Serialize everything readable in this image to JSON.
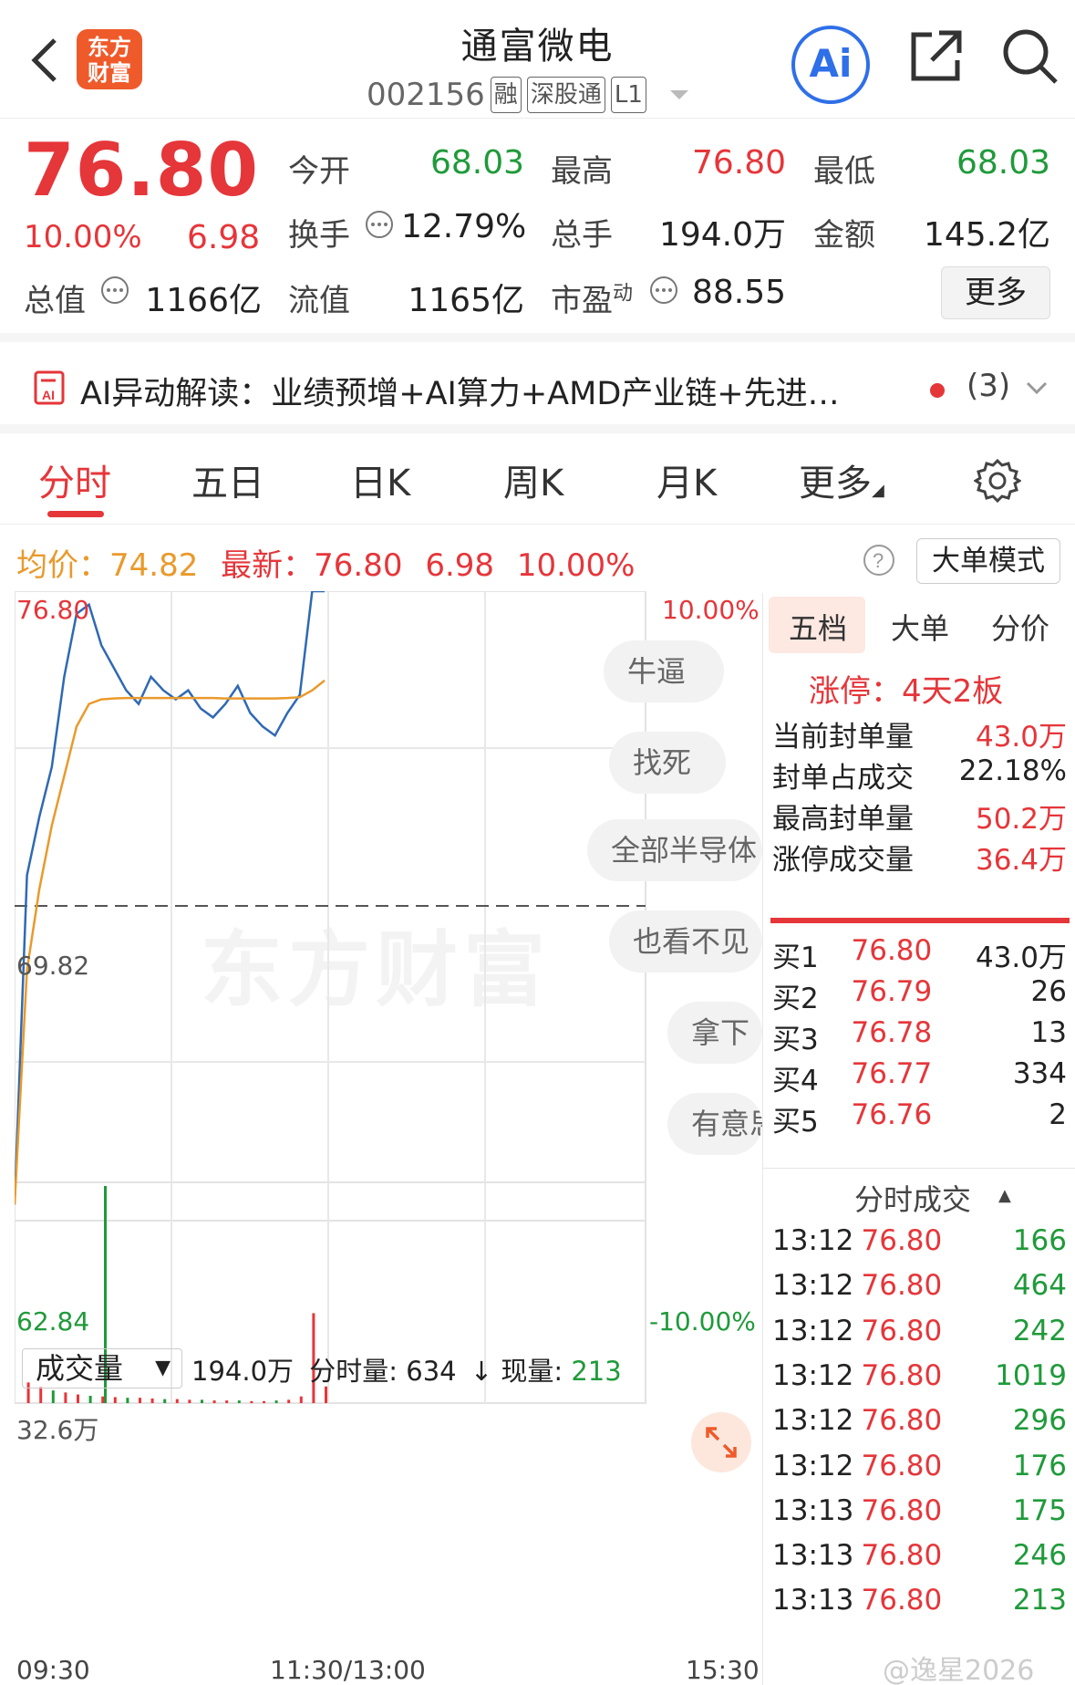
{
  "header": {
    "logo_text_1": "东方",
    "logo_text_2": "财富",
    "title": "通富微电",
    "code": "002156",
    "tags": [
      "融",
      "深股通",
      "L1"
    ],
    "ai_label": "Ai"
  },
  "quote": {
    "price": "76.80",
    "change_pct": "10.00%",
    "change": "6.98",
    "open_label": "今开",
    "open": "68.03",
    "high_label": "最高",
    "high": "76.80",
    "low_label": "最低",
    "low": "68.03",
    "turnover_label": "换手",
    "turnover": "12.79%",
    "volume_label": "总手",
    "volume": "194.0万",
    "amount_label": "金额",
    "amount": "145.2亿",
    "mktcap_label": "总值",
    "mktcap": "1166亿",
    "float_label": "流值",
    "float": "1165亿",
    "pe_label": "市盈",
    "pe_sup": "动",
    "pe": "88.55",
    "more_label": "更多"
  },
  "ai_bar": {
    "text": "AI异动解读：业绩预增+AI算力+AMD产业链+先进…",
    "count": "(3)"
  },
  "tabs": [
    "分时",
    "五日",
    "日K",
    "周K",
    "月K",
    "更多"
  ],
  "info_line": {
    "avg_label": "均价：",
    "avg": "74.82",
    "latest_label": "最新：",
    "latest": "76.80",
    "chg": "6.98",
    "pct": "10.00%",
    "mode_btn": "大单模式"
  },
  "chart": {
    "y_top": "76.80",
    "y_mid": "69.82",
    "y_bottom": "62.84",
    "pct_top": "10.00%",
    "pct_bottom": "-10.00%",
    "x_labels": [
      "09:30",
      "11:30/13:00",
      "15:30"
    ],
    "watermark": "东方财富",
    "vol_max": "32.6万"
  },
  "chart_data": {
    "type": "line",
    "title": "",
    "xlabel": "",
    "ylabel": "",
    "ylim": [
      62.84,
      76.8
    ],
    "series": [
      {
        "name": "最新",
        "values": [
          63.2,
          70.5,
          71.8,
          72.9,
          74.9,
          76.3,
          76.5,
          75.6,
          75.1,
          74.6,
          74.3,
          74.9,
          74.6,
          74.4,
          74.6,
          74.2,
          74.0,
          74.3,
          74.7,
          74.1,
          73.8,
          73.6,
          74.1,
          74.5,
          76.8,
          76.8
        ]
      },
      {
        "name": "均价",
        "values": [
          63.2,
          68.4,
          70.2,
          71.6,
          72.7,
          73.8,
          74.3,
          74.4,
          74.42,
          74.43,
          74.43,
          74.43,
          74.43,
          74.43,
          74.43,
          74.43,
          74.43,
          74.42,
          74.42,
          74.42,
          74.42,
          74.42,
          74.43,
          74.45,
          74.6,
          74.82
        ]
      }
    ],
    "volume": [
      32.6,
      3.1,
      2.4,
      1.9,
      1.6,
      1.3,
      1.1,
      1.0,
      0.9,
      0.8,
      0.8,
      0.7,
      0.6,
      0.6,
      0.5,
      0.5,
      0.4,
      0.4,
      0.4,
      0.3,
      0.3,
      0.4,
      0.5,
      1.0,
      13.5,
      2.5
    ]
  },
  "volume_bar": {
    "select": "成交量",
    "total": "194.0万",
    "period_label": "分时量:",
    "period": "634",
    "now_label": "现量:",
    "now": "213"
  },
  "bubbles": [
    "牛逼",
    "找死",
    "全部半导体",
    "也看不见",
    "拿下",
    "有意思"
  ],
  "right": {
    "tabs": [
      "五档",
      "大单",
      "分价"
    ],
    "limit_text": "涨停：4天2板",
    "stats": [
      {
        "label": "当前封单量",
        "value": "43.0万"
      },
      {
        "label": "封单占成交",
        "value": "22.18%"
      },
      {
        "label": "最高封单量",
        "value": "50.2万"
      },
      {
        "label": "涨停成交量",
        "value": "36.4万"
      }
    ],
    "bids": [
      {
        "label": "买1",
        "price": "76.80",
        "vol": "43.0万"
      },
      {
        "label": "买2",
        "price": "76.79",
        "vol": "26"
      },
      {
        "label": "买3",
        "price": "76.78",
        "vol": "13"
      },
      {
        "label": "买4",
        "price": "76.77",
        "vol": "334"
      },
      {
        "label": "买5",
        "price": "76.76",
        "vol": "2"
      }
    ],
    "ticks_title": "分时成交",
    "ticks": [
      {
        "time": "13:12",
        "price": "76.80",
        "vol": "166"
      },
      {
        "time": "13:12",
        "price": "76.80",
        "vol": "464"
      },
      {
        "time": "13:12",
        "price": "76.80",
        "vol": "242"
      },
      {
        "time": "13:12",
        "price": "76.80",
        "vol": "1019"
      },
      {
        "time": "13:12",
        "price": "76.80",
        "vol": "296"
      },
      {
        "time": "13:12",
        "price": "76.80",
        "vol": "176"
      },
      {
        "time": "13:13",
        "price": "76.80",
        "vol": "175"
      },
      {
        "time": "13:13",
        "price": "76.80",
        "vol": "246"
      },
      {
        "time": "13:13",
        "price": "76.80",
        "vol": "213"
      }
    ]
  },
  "watermark_weibo": "@逸星2026",
  "colors": {
    "up": "#e5363a",
    "down": "#1f9a3a",
    "avg": "#e99a2c",
    "price_line": "#2f69b3"
  }
}
